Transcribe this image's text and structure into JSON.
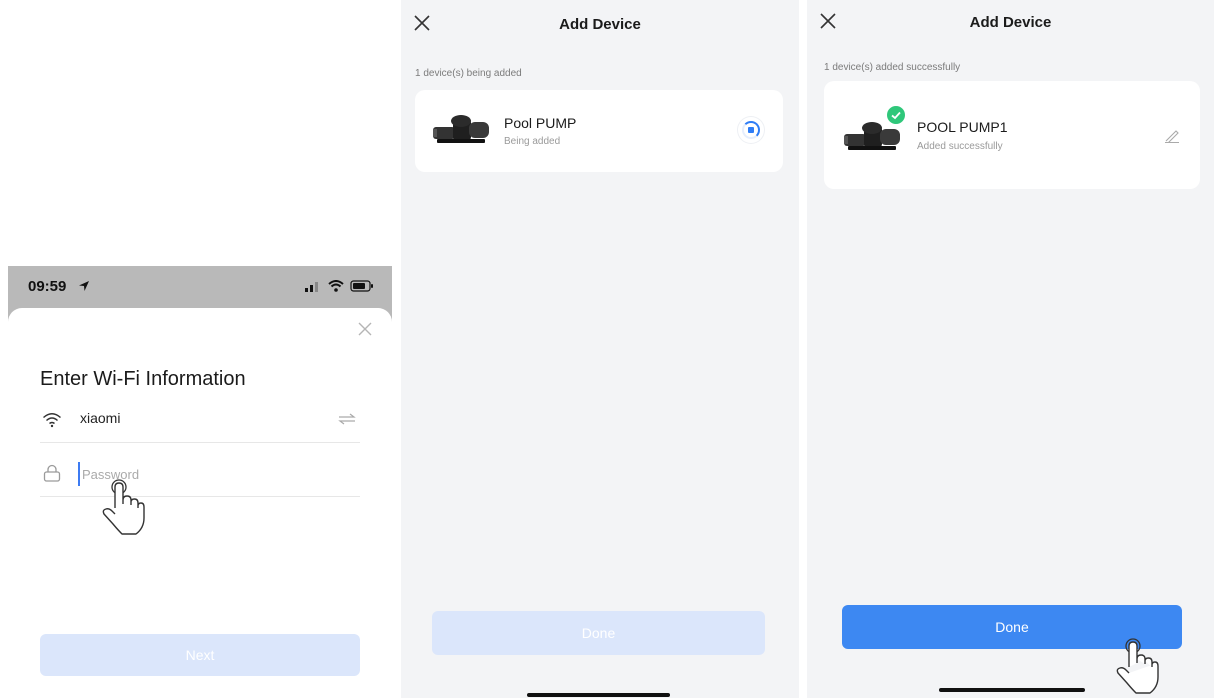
{
  "wifi_screen": {
    "status_time": "09:59",
    "title": "Enter Wi-Fi Information",
    "ssid": "xiaomi",
    "password_placeholder": "Password",
    "next_label": "Next"
  },
  "adding_screen": {
    "title": "Add Device",
    "subtitle": "1 device(s) being added",
    "device_name": "Pool PUMP",
    "device_status": "Being added",
    "done_label": "Done"
  },
  "success_screen": {
    "title": "Add Device",
    "subtitle": "1 device(s) added successfully",
    "device_name": "POOL PUMP1",
    "device_status": "Added successfully",
    "done_label": "Done"
  },
  "colors": {
    "accent": "#3d88f2",
    "disabled_button": "#dbe6fb",
    "success_badge": "#2fc77a"
  },
  "icons": [
    "location-arrow-icon",
    "signal-icon",
    "wifi-icon",
    "battery-icon",
    "close-icon",
    "switch-network-icon",
    "lock-icon",
    "tap-hand-icon",
    "pool-pump-image",
    "loading-spinner-icon",
    "checkmark-icon",
    "edit-pencil-icon"
  ]
}
